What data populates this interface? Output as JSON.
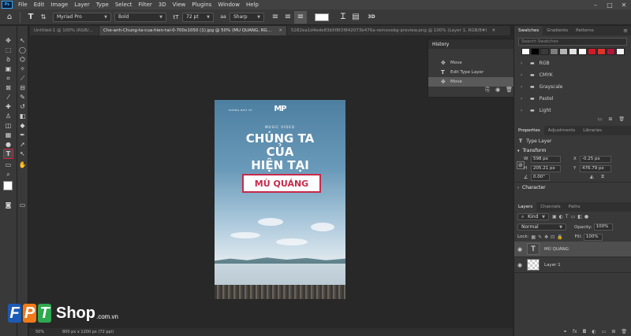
{
  "menu": [
    "File",
    "Edit",
    "Image",
    "Layer",
    "Type",
    "Select",
    "Filter",
    "3D",
    "View",
    "Plugins",
    "Window",
    "Help"
  ],
  "app_icon": "Ps",
  "window_controls": [
    "–",
    "□",
    "✕"
  ],
  "options_bar": {
    "font_family": "Myriad Pro",
    "font_style": "Bold",
    "font_size": "72 pt",
    "antialias": "Sharp",
    "icons": [
      "home-icon",
      "type-tool-icon",
      "orientation-icon",
      "align-left-icon",
      "align-center-icon",
      "align-right-icon",
      "color-swatch",
      "warp-text-icon",
      "character-panel-icon",
      "3d-icon"
    ]
  },
  "tabs": [
    {
      "label": "Untitled-1 @ 100% (RGB/...",
      "close": "✕",
      "active": false
    },
    {
      "label": "Che-anh-Chung-ta-cua-hien-tai-0-700x1050 (1).jpg @ 50% (MÙ QUÁNG, RGB/8#) *",
      "close": "✕",
      "active": true
    },
    {
      "label": "5282ea1d4ede83b5f8f2f842073b476a-removebg-preview.png @ 100% (Layer 1, RGB/8#)",
      "close": "✕",
      "active": false
    }
  ],
  "history": {
    "title": "History",
    "items": [
      {
        "label": "Move",
        "icon": "move-icon",
        "active": false
      },
      {
        "label": "Edit Type Layer",
        "icon": "type-icon",
        "active": false
      },
      {
        "label": "Move",
        "icon": "move-icon",
        "active": true
      }
    ]
  },
  "swatches": {
    "tabs": [
      "Swatches",
      "Gradients",
      "Patterns"
    ],
    "search_placeholder": "Search Swatches",
    "colors": [
      "#ffffff",
      "#000000",
      "#3a3a3a",
      "#7d7d7d",
      "#b5b5b5",
      "#e3e3e3",
      "#ffffff",
      "#d21b2a",
      "#e0332d",
      "#b0183a",
      "#f2f2f2"
    ],
    "groups": [
      "RGB",
      "CMYK",
      "Grayscale",
      "Pastel",
      "Light"
    ]
  },
  "properties": {
    "tabs": [
      "Properties",
      "Adjustments",
      "Libraries"
    ],
    "layer_type": "Type Layer",
    "section": "Transform",
    "w_label": "W",
    "w": "598 px",
    "h_label": "H",
    "h": "205.21 px",
    "x_label": "X",
    "x": "-0.25 px",
    "y_label": "Y",
    "y": "476.79 px",
    "angle": "0.00°",
    "character": "Character"
  },
  "layers": {
    "tabs": [
      "Layers",
      "Channels",
      "Paths"
    ],
    "kind": "Kind",
    "blend": "Normal",
    "opacity_label": "Opacity:",
    "opacity": "100%",
    "lock_label": "Lock:",
    "fill_label": "Fill:",
    "fill": "100%",
    "items": [
      {
        "name": "MÙ QUÁNG",
        "thumb": "T",
        "active": true
      },
      {
        "name": "Layer 1",
        "thumb": "",
        "active": false
      }
    ]
  },
  "poster": {
    "brand": "KHÔNG NHƯ TP",
    "logo": "MP",
    "subtitle": "MUSIC VIDEO",
    "line1": "CHÚNG TA",
    "line2": "CỦA",
    "line3": "HIỆN TẠI",
    "selected_text": "MÙ QUÁNG"
  },
  "status": {
    "zoom": "50%",
    "doc": "800 px x 1200 px (72 ppi)"
  },
  "watermark": {
    "letters": [
      "F",
      "P",
      "T"
    ],
    "shop": "Shop",
    ".com.vn": ".com.vn",
    "colors": [
      "#1c5bb5",
      "#f07a1a",
      "#2fa84f"
    ]
  }
}
